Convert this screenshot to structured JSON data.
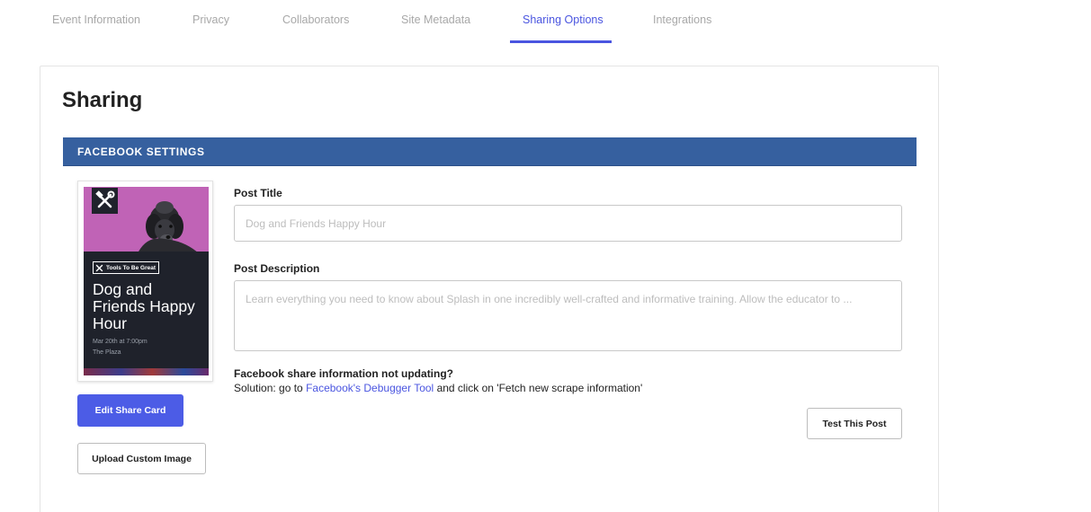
{
  "tabs": [
    {
      "label": "Event Information",
      "active": false
    },
    {
      "label": "Privacy",
      "active": false
    },
    {
      "label": "Collaborators",
      "active": false
    },
    {
      "label": "Site Metadata",
      "active": false
    },
    {
      "label": "Sharing Options",
      "active": true
    },
    {
      "label": "Integrations",
      "active": false
    }
  ],
  "page": {
    "title": "Sharing"
  },
  "facebook": {
    "header": "FACEBOOK SETTINGS",
    "post_title_label": "Post Title",
    "post_title_placeholder": "Dog and Friends Happy Hour",
    "post_description_label": "Post Description",
    "post_description_placeholder": "Learn everything you need to know about Splash in one incredibly well-crafted and informative training. Allow the educator to ...",
    "help_title": "Facebook share information not updating?",
    "help_prefix": "Solution: go to ",
    "help_link": "Facebook's Debugger Tool",
    "help_suffix": " and click on 'Fetch new scrape information'",
    "edit_share_card": "Edit Share Card",
    "upload_custom_image": "Upload Custom Image",
    "test_post": "Test This Post"
  },
  "share_card": {
    "org_name": "Tools To Be Great",
    "event_name": "Dog and Friends Happy Hour",
    "event_date": "Mar 20th at 7:00pm",
    "event_venue": "The Plaza"
  },
  "icons": {
    "logo": "tools-icon",
    "org_tag": "tools-icon"
  },
  "colors": {
    "accent": "#4a55e0",
    "facebook_header": "#36609f",
    "primary_button": "#4c5ce6",
    "card_background": "#1f222b",
    "photo_background": "#c063b6"
  }
}
